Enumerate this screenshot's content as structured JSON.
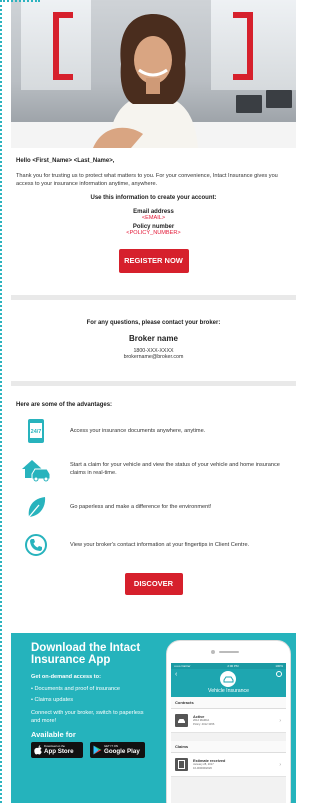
{
  "greeting": "Hello <First_Name> <Last_Name>,",
  "intro": "Thank you for trusting us to protect what matters to you. For your convenience, Intact Insurance gives you access to your insurance information anytime, anywhere.",
  "use_info": "Use this information to create your account:",
  "email_label": "Email address",
  "email_value": "<EMAIL>",
  "policy_label": "Policy number",
  "policy_value": "<POLICY_NUMBER>",
  "register_button": "REGISTER NOW",
  "broker": {
    "question": "For any questions, please contact your broker:",
    "name": "Broker name",
    "phone": "1800-XXX-XXXX",
    "email": "brokername@broker.com"
  },
  "advantages": {
    "title": "Here are some of the advantages:",
    "items": [
      {
        "icon": "phone-24-7-icon",
        "icon_text": "24/7",
        "text": "Access your insurance documents anywhere, anytime."
      },
      {
        "icon": "car-house-icon",
        "text": "Start a claim for your vehicle and view the status of your vehicle and home insurance claims in real-time."
      },
      {
        "icon": "leaf-icon",
        "text": "Go paperless and make a difference for the environment!"
      },
      {
        "icon": "phone-call-icon",
        "text": "View your broker's contact information at your fingertips in Client Centre."
      }
    ]
  },
  "discover_button": "DISCOVER",
  "promo": {
    "title": "Download the Intact Insurance App",
    "subtitle": "Get on-demand access to:",
    "bullets": [
      "Documents and proof of insurance",
      "Claims updates"
    ],
    "connect": "Connect with your broker, switch to paperless and more!",
    "available": "Available for",
    "apple_small": "Download on the",
    "apple_big": "App Store",
    "google_small": "GET IT ON",
    "google_big": "Google Play"
  },
  "phone_screen": {
    "carrier": "•••oo Carrier",
    "time": "2:00 PM",
    "battery": "100%",
    "header_title": "Vehicle Insurance",
    "contracts_label": "Contracts",
    "contract_status": "Active",
    "contract_vehicle": "2012 MAZDA",
    "contract_policy": "Policy: 4012 3456",
    "claims_label": "Claims",
    "claim_status": "Estimate received",
    "claim_date": "January 28, 2017",
    "claim_number": "16-0000002026"
  },
  "colors": {
    "accent_red": "#d6202c",
    "teal": "#25b3bc"
  }
}
